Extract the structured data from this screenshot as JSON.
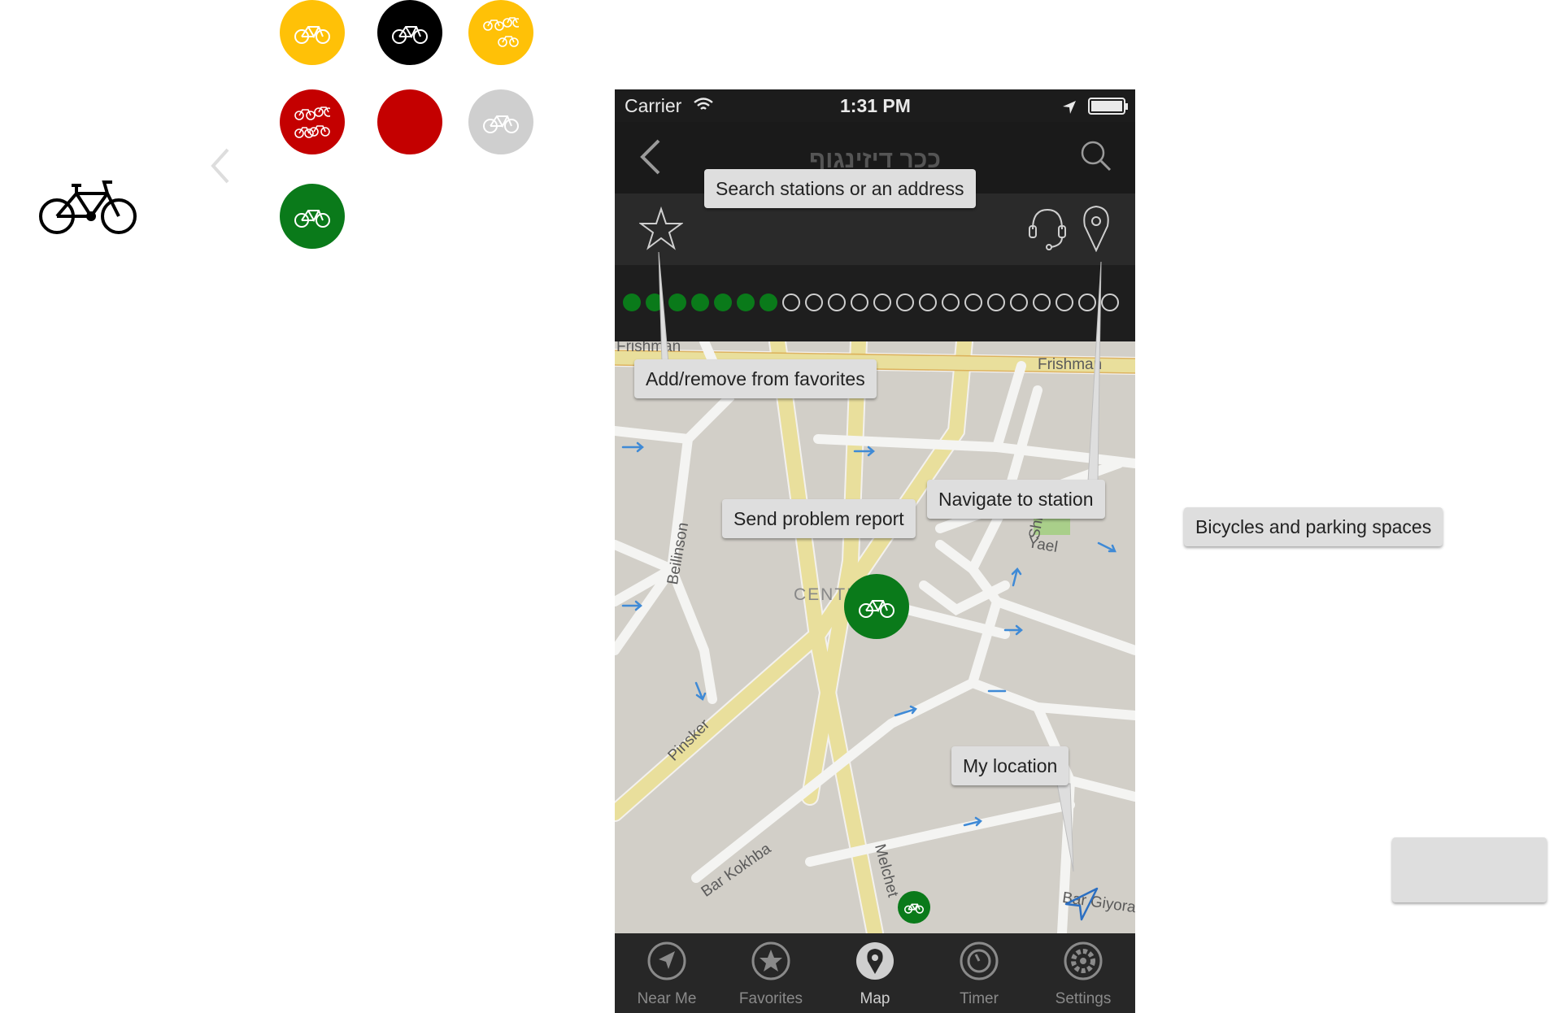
{
  "status_bar": {
    "carrier": "Carrier",
    "time": "1:31 PM"
  },
  "nav": {
    "title": "ככר דיזינגוף"
  },
  "availability": {
    "bikes": 7,
    "total": 22
  },
  "tooltips": {
    "search": "Search stations or an address",
    "favorites": "Add/remove from favorites",
    "problem": "Send problem report",
    "navigate": "Navigate to station",
    "my_location": "My location",
    "bicycles_parking": "Bicycles and parking spaces"
  },
  "map_labels": {
    "frishman_left": "Frishman",
    "frishman_right": "Frishman",
    "beilinson": "Beilinson",
    "center": "CENTER",
    "yael": "Yael",
    "shlomo": "Shlomo",
    "pinsker": "Pinsker",
    "bar_kokhba": "Bar Kokhba",
    "melchet": "Melchet",
    "bar_giyora": "Bar Giyora"
  },
  "tabs": [
    {
      "label": "Near Me",
      "icon": "location-arrow-icon"
    },
    {
      "label": "Favorites",
      "icon": "star-icon"
    },
    {
      "label": "Map",
      "icon": "map-pin-icon",
      "active": true
    },
    {
      "label": "Timer",
      "icon": "timer-icon"
    },
    {
      "label": "Settings",
      "icon": "gear-icon"
    }
  ],
  "colors": {
    "station_green": "#0a7a1a",
    "yellow": "#ffc107",
    "red": "#c40000",
    "grey": "#cfcfcf",
    "black": "#000000"
  }
}
